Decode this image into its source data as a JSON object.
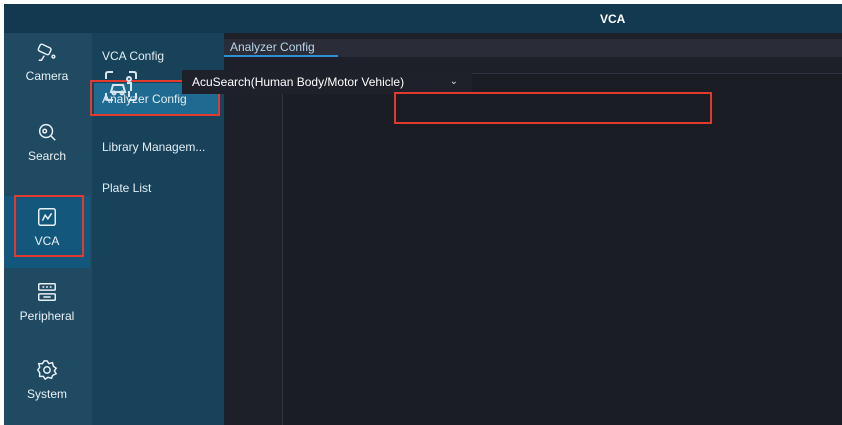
{
  "window": {
    "title": "VCA"
  },
  "sidebar": {
    "items": [
      {
        "label": "Camera",
        "icon": "camera-icon"
      },
      {
        "label": "Search",
        "icon": "search-icon"
      },
      {
        "label": "VCA",
        "icon": "vca-icon",
        "active": true
      },
      {
        "label": "Peripheral",
        "icon": "peripheral-icon"
      },
      {
        "label": "System",
        "icon": "gear-icon"
      }
    ]
  },
  "subnav": {
    "items": [
      {
        "label": "VCA Config"
      },
      {
        "label": "Analyzer Config",
        "active": true
      },
      {
        "label": "Library Managem..."
      },
      {
        "label": "Plate List"
      }
    ]
  },
  "main": {
    "tabs": [
      {
        "label": "Analyzer Config",
        "active": true
      }
    ],
    "analyzer_icon": "analyzer-icon",
    "analyzer_select": {
      "value": "AcuSearch(Human Body/Motor Vehicle)",
      "chevron": "chevron-down-icon"
    }
  },
  "colors": {
    "title_bar": "#12394f",
    "rail": "#1f4a62",
    "rail_active": "#13587c",
    "subnav": "#174259",
    "subnav_active": "#1f6a90",
    "main_bg": "#1e2029",
    "accent": "#2f8fd0",
    "highlight_red": "#e23a2e"
  }
}
